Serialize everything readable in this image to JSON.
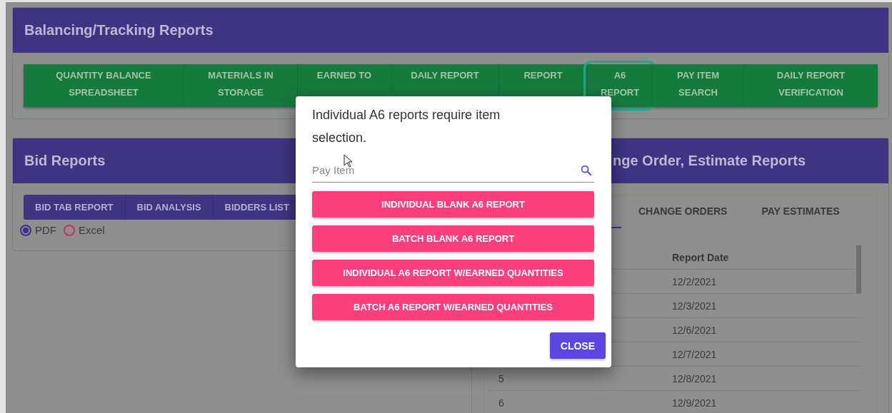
{
  "balancing_panel": {
    "title": "Balancing/Tracking Reports",
    "buttons": [
      {
        "label": "QUANTITY BALANCE SPREADSHEET",
        "focused": false
      },
      {
        "label": "MATERIALS IN STORAGE",
        "focused": false
      },
      {
        "label": "EARNED TO",
        "focused": false
      },
      {
        "label": "DAILY REPORT",
        "focused": false
      },
      {
        "label": "REPORT",
        "focused": false
      },
      {
        "label": "A6 REPORT",
        "focused": true
      },
      {
        "label": "PAY ITEM SEARCH",
        "focused": false
      },
      {
        "label": "DAILY REPORT VERIFICATION",
        "focused": false
      }
    ]
  },
  "bid_panel": {
    "title": "Bid Reports",
    "buttons": [
      "BID TAB REPORT",
      "BID ANALYSIS",
      "BIDDERS LIST"
    ],
    "formats": [
      {
        "label": "PDF",
        "selected": true
      },
      {
        "label": "Excel",
        "selected": false
      }
    ]
  },
  "estimate_panel": {
    "title": "nge Order, Estimate Reports",
    "tabs": [
      {
        "selected": true
      },
      {
        "label": "CHANGE ORDERS",
        "selected": false
      },
      {
        "label": "PAY ESTIMATES",
        "selected": false
      }
    ],
    "table": {
      "columns": [
        "Report Date"
      ],
      "rows": [
        {
          "report_date": "12/2/2021"
        },
        {
          "report_date": "12/3/2021"
        },
        {
          "report_date": "12/6/2021"
        },
        {
          "report_date": "12/7/2021"
        },
        {
          "column_1": "5",
          "report_date": "12/8/2021"
        },
        {
          "column_1": "6",
          "report_date": "12/9/2021"
        }
      ]
    }
  },
  "dialog": {
    "message": "Individual A6 reports require item selection.",
    "field": {
      "placeholder": "Pay Item"
    },
    "actions": [
      "INDIVIDUAL BLANK A6 REPORT",
      "BATCH BLANK A6 REPORT",
      "INDIVIDUAL A6 REPORT W/EARNED QUANTITIES",
      "BATCH A6 REPORT W/EARNED QUANTITIES"
    ],
    "close": "CLOSE"
  }
}
